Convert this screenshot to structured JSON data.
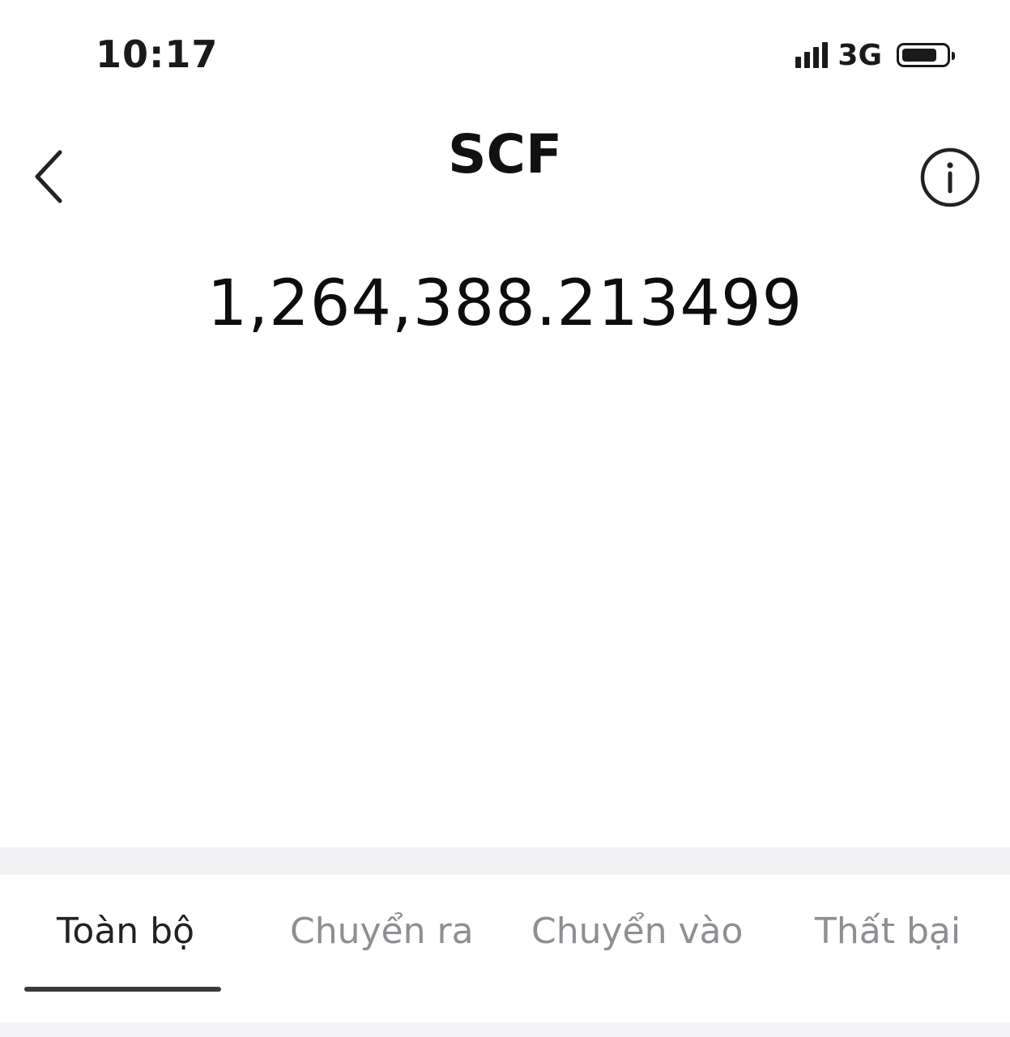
{
  "status_bar": {
    "time": "10:17",
    "network": "3G",
    "battery_level": 0.8,
    "signal_icon": "signal-bars-icon",
    "battery_icon": "battery-icon"
  },
  "header": {
    "title": "SCF",
    "back_icon": "chevron-left-icon",
    "info_icon": "info-circle-icon"
  },
  "balance": {
    "amount": "1,264,388.213499"
  },
  "tabs": [
    {
      "label": "Toàn bộ",
      "active": true
    },
    {
      "label": "Chuyển ra",
      "active": false
    },
    {
      "label": "Chuyển vào",
      "active": false
    },
    {
      "label": "Thất bại",
      "active": false
    }
  ],
  "colors": {
    "text_primary": "#111111",
    "tab_inactive": "#8e8e93",
    "indicator": "#3a3a3a",
    "section_gap": "#f2f2f4"
  }
}
